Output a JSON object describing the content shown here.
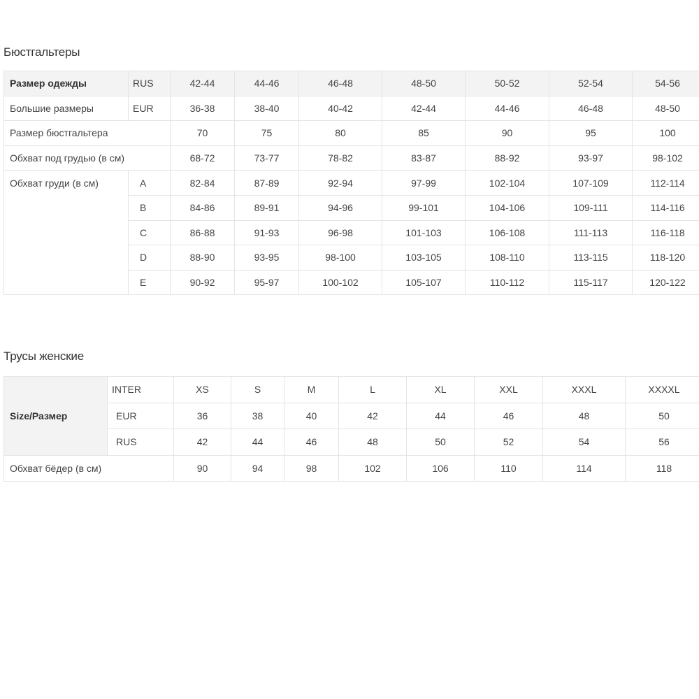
{
  "bra": {
    "title": "Бюстгальтеры",
    "rows": {
      "clothing_size": {
        "label": "Размер одежды",
        "code": "RUS",
        "values": [
          "42-44",
          "44-46",
          "46-48",
          "48-50",
          "50-52",
          "52-54",
          "54-56"
        ]
      },
      "large_sizes": {
        "label": "Большие размеры",
        "code": "EUR",
        "values": [
          "36-38",
          "38-40",
          "40-42",
          "42-44",
          "44-46",
          "46-48",
          "48-50"
        ]
      },
      "bra_size": {
        "label": "Размер бюстгальтера",
        "values": [
          "70",
          "75",
          "80",
          "85",
          "90",
          "95",
          "100"
        ]
      },
      "underbust": {
        "label": "Обхват под грудью (в см)",
        "values": [
          "68-72",
          "73-77",
          "78-82",
          "83-87",
          "88-92",
          "93-97",
          "98-102"
        ]
      },
      "bust": {
        "label": "Обхват груди (в см)",
        "cups": [
          {
            "cup": "A",
            "values": [
              "82-84",
              "87-89",
              "92-94",
              "97-99",
              "102-104",
              "107-109",
              "112-114"
            ]
          },
          {
            "cup": "B",
            "values": [
              "84-86",
              "89-91",
              "94-96",
              "99-101",
              "104-106",
              "109-111",
              "114-116"
            ]
          },
          {
            "cup": "C",
            "values": [
              "86-88",
              "91-93",
              "96-98",
              "101-103",
              "106-108",
              "111-113",
              "116-118"
            ]
          },
          {
            "cup": "D",
            "values": [
              "88-90",
              "93-95",
              "98-100",
              "103-105",
              "108-110",
              "113-115",
              "118-120"
            ]
          },
          {
            "cup": "E",
            "values": [
              "90-92",
              "95-97",
              "100-102",
              "105-107",
              "110-112",
              "115-117",
              "120-122"
            ]
          }
        ]
      }
    }
  },
  "panties": {
    "title": "Трусы женские",
    "size_label": "Size/Размер",
    "inter": {
      "label": "INTER",
      "values": [
        "XS",
        "S",
        "M",
        "L",
        "XL",
        "XXL",
        "XXXL",
        "XXXXL"
      ]
    },
    "eur": {
      "label": "EUR",
      "values": [
        "36",
        "38",
        "40",
        "42",
        "44",
        "46",
        "48",
        "50"
      ]
    },
    "rus": {
      "label": "RUS",
      "values": [
        "42",
        "44",
        "46",
        "48",
        "50",
        "52",
        "54",
        "56"
      ]
    },
    "hips": {
      "label": "Обхват бёдер (в см)",
      "values": [
        "90",
        "94",
        "98",
        "102",
        "106",
        "110",
        "114",
        "118"
      ]
    }
  }
}
